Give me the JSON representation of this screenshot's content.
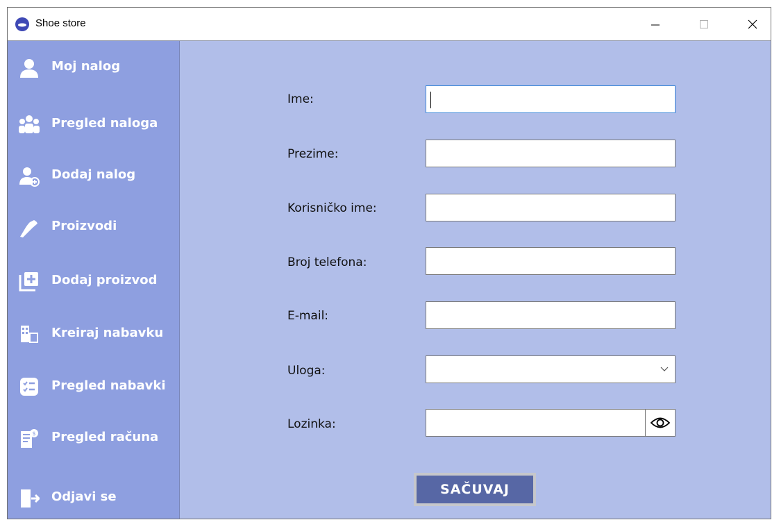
{
  "window": {
    "title": "Shoe store"
  },
  "sidebar": {
    "items": [
      {
        "label": "Moj nalog",
        "icon": "user-icon"
      },
      {
        "label": "Pregled naloga",
        "icon": "users-icon"
      },
      {
        "label": "Dodaj nalog",
        "icon": "add-user-icon"
      },
      {
        "label": "Proizvodi",
        "icon": "shoe-icon"
      },
      {
        "label": "Dodaj proizvod",
        "icon": "add-box-icon"
      },
      {
        "label": "Kreiraj nabavku",
        "icon": "supply-icon"
      },
      {
        "label": "Pregled nabavki",
        "icon": "checklist-icon"
      },
      {
        "label": "Pregled računa",
        "icon": "bill-icon"
      }
    ],
    "logout": {
      "label": "Odjavi se",
      "icon": "logout-icon"
    }
  },
  "form": {
    "fields": [
      {
        "label": "Ime:",
        "value": ""
      },
      {
        "label": "Prezime:",
        "value": ""
      },
      {
        "label": "Korisničko ime:",
        "value": ""
      },
      {
        "label": "Broj telefona:",
        "value": ""
      },
      {
        "label": "E-mail:",
        "value": ""
      },
      {
        "label": "Uloga:",
        "value": ""
      },
      {
        "label": "Lozinka:",
        "value": ""
      }
    ],
    "save_label": "SAČUVAJ"
  },
  "colors": {
    "sidebar": "#8e9fe0",
    "content": "#b1bee9",
    "button": "#5767a5"
  }
}
